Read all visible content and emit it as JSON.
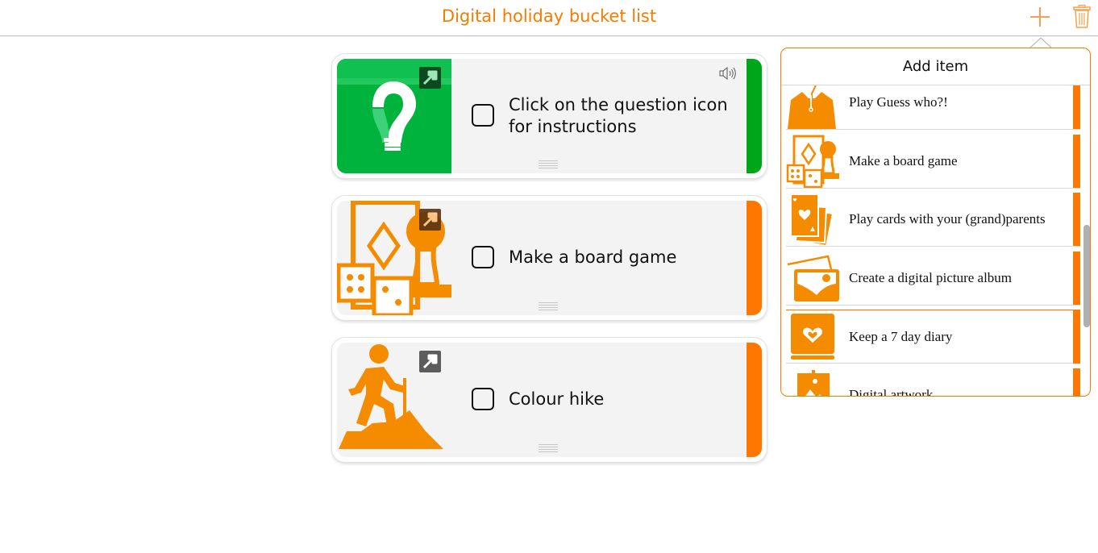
{
  "header": {
    "title": "Digital holiday bucket list",
    "add_icon": "plus-icon",
    "trash_icon": "trash-icon"
  },
  "colors": {
    "accent": "#f57c00",
    "orange_bar": "#ff7700",
    "green_bar": "#00a619",
    "green_tile": "#00b33c",
    "card_bg": "#f3f3f3"
  },
  "cards": [
    {
      "text_line1": "Click on the question icon",
      "text_line2": "for instructions",
      "checked": false,
      "image": "question-bulb-icon",
      "bar_color": "#00a619",
      "has_sound": true
    },
    {
      "text_line1": "Make a board game",
      "checked": false,
      "image": "board-game-icon",
      "bar_color": "#ff7700"
    },
    {
      "text_line1": "Colour hike",
      "checked": false,
      "image": "hiker-icon",
      "bar_color": "#ff7700"
    }
  ],
  "popover": {
    "title": "Add item",
    "items": [
      {
        "label": "Play Guess who?!",
        "icon": "person-icon"
      },
      {
        "label": "Make a board game",
        "icon": "board-game-icon"
      },
      {
        "label": "Play cards with your (grand)parents",
        "icon": "playing-cards-icon"
      },
      {
        "label": "Create a digital picture album",
        "icon": "photo-album-icon"
      },
      {
        "label": "Keep a 7 day diary",
        "icon": "diary-icon"
      },
      {
        "label": "Digital artwork",
        "icon": "artwork-icon"
      }
    ]
  }
}
